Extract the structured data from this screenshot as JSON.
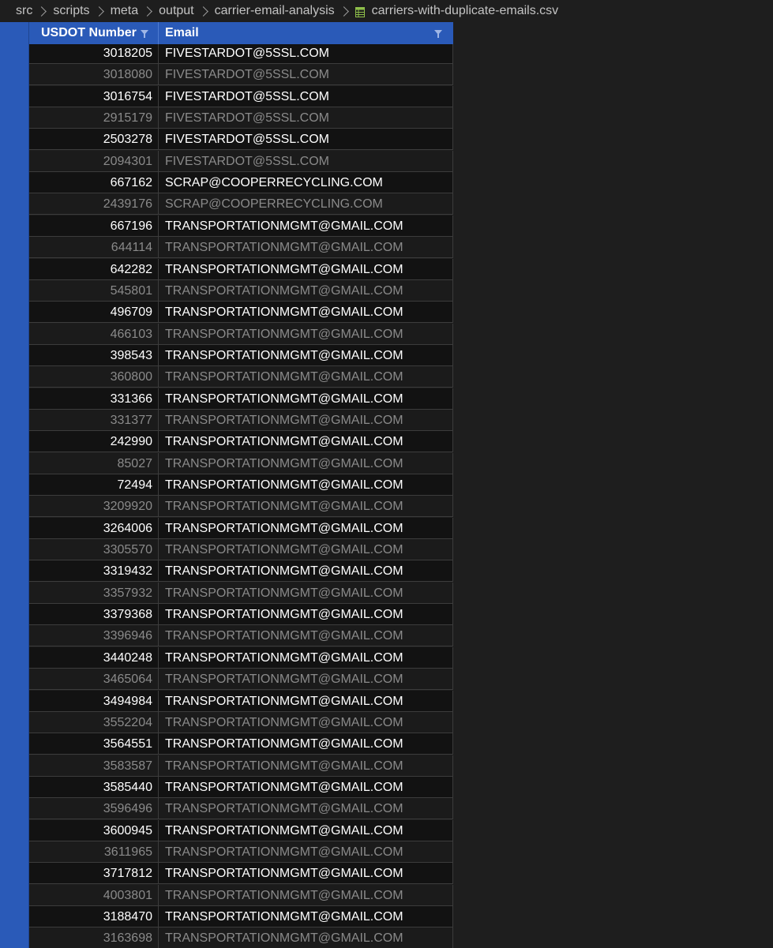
{
  "breadcrumb": {
    "segments": [
      "src",
      "scripts",
      "meta",
      "output",
      "carrier-email-analysis"
    ],
    "file": "carriers-with-duplicate-emails.csv",
    "file_icon": "csv-table-icon"
  },
  "table": {
    "columns": [
      "USDOT Number",
      "Email"
    ],
    "rows": [
      [
        "3018205",
        "FIVESTARDOT@5SSL.COM"
      ],
      [
        "3018080",
        "FIVESTARDOT@5SSL.COM"
      ],
      [
        "3016754",
        "FIVESTARDOT@5SSL.COM"
      ],
      [
        "2915179",
        "FIVESTARDOT@5SSL.COM"
      ],
      [
        "2503278",
        "FIVESTARDOT@5SSL.COM"
      ],
      [
        "2094301",
        "FIVESTARDOT@5SSL.COM"
      ],
      [
        "667162",
        "SCRAP@COOPERRECYCLING.COM"
      ],
      [
        "2439176",
        "SCRAP@COOPERRECYCLING.COM"
      ],
      [
        "667196",
        "TRANSPORTATIONMGMT@GMAIL.COM"
      ],
      [
        "644114",
        "TRANSPORTATIONMGMT@GMAIL.COM"
      ],
      [
        "642282",
        "TRANSPORTATIONMGMT@GMAIL.COM"
      ],
      [
        "545801",
        "TRANSPORTATIONMGMT@GMAIL.COM"
      ],
      [
        "496709",
        "TRANSPORTATIONMGMT@GMAIL.COM"
      ],
      [
        "466103",
        "TRANSPORTATIONMGMT@GMAIL.COM"
      ],
      [
        "398543",
        "TRANSPORTATIONMGMT@GMAIL.COM"
      ],
      [
        "360800",
        "TRANSPORTATIONMGMT@GMAIL.COM"
      ],
      [
        "331366",
        "TRANSPORTATIONMGMT@GMAIL.COM"
      ],
      [
        "331377",
        "TRANSPORTATIONMGMT@GMAIL.COM"
      ],
      [
        "242990",
        "TRANSPORTATIONMGMT@GMAIL.COM"
      ],
      [
        "85027",
        "TRANSPORTATIONMGMT@GMAIL.COM"
      ],
      [
        "72494",
        "TRANSPORTATIONMGMT@GMAIL.COM"
      ],
      [
        "3209920",
        "TRANSPORTATIONMGMT@GMAIL.COM"
      ],
      [
        "3264006",
        "TRANSPORTATIONMGMT@GMAIL.COM"
      ],
      [
        "3305570",
        "TRANSPORTATIONMGMT@GMAIL.COM"
      ],
      [
        "3319432",
        "TRANSPORTATIONMGMT@GMAIL.COM"
      ],
      [
        "3357932",
        "TRANSPORTATIONMGMT@GMAIL.COM"
      ],
      [
        "3379368",
        "TRANSPORTATIONMGMT@GMAIL.COM"
      ],
      [
        "3396946",
        "TRANSPORTATIONMGMT@GMAIL.COM"
      ],
      [
        "3440248",
        "TRANSPORTATIONMGMT@GMAIL.COM"
      ],
      [
        "3465064",
        "TRANSPORTATIONMGMT@GMAIL.COM"
      ],
      [
        "3494984",
        "TRANSPORTATIONMGMT@GMAIL.COM"
      ],
      [
        "3552204",
        "TRANSPORTATIONMGMT@GMAIL.COM"
      ],
      [
        "3564551",
        "TRANSPORTATIONMGMT@GMAIL.COM"
      ],
      [
        "3583587",
        "TRANSPORTATIONMGMT@GMAIL.COM"
      ],
      [
        "3585440",
        "TRANSPORTATIONMGMT@GMAIL.COM"
      ],
      [
        "3596496",
        "TRANSPORTATIONMGMT@GMAIL.COM"
      ],
      [
        "3600945",
        "TRANSPORTATIONMGMT@GMAIL.COM"
      ],
      [
        "3611965",
        "TRANSPORTATIONMGMT@GMAIL.COM"
      ],
      [
        "3717812",
        "TRANSPORTATIONMGMT@GMAIL.COM"
      ],
      [
        "4003801",
        "TRANSPORTATIONMGMT@GMAIL.COM"
      ],
      [
        "3188470",
        "TRANSPORTATIONMGMT@GMAIL.COM"
      ],
      [
        "3163698",
        "TRANSPORTATIONMGMT@GMAIL.COM"
      ]
    ]
  },
  "colors": {
    "header_bg": "#2a5ab8",
    "page_bg": "#1e1e1e",
    "row_bright_text": "#ffffff",
    "row_dim_text": "#8a8a8a"
  }
}
